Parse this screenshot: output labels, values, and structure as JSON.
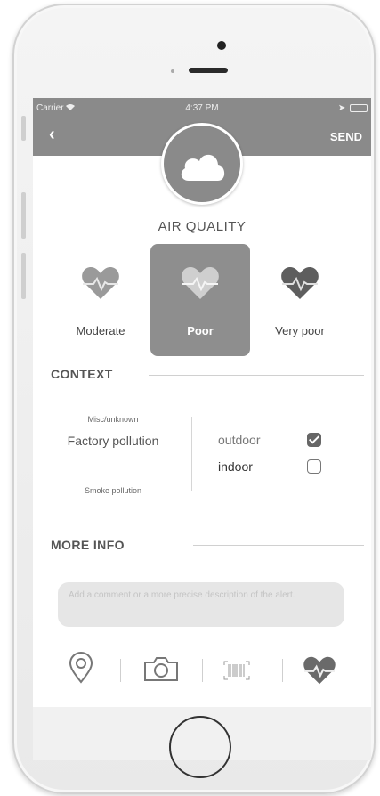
{
  "status_bar": {
    "carrier": "Carrier",
    "time": "4:37 PM"
  },
  "header": {
    "back": "‹",
    "send": "SEND",
    "icon": "cloud-icon"
  },
  "air_quality": {
    "title": "AIR QUALITY",
    "options": [
      {
        "label": "Moderate",
        "icon": "heart-pulse-icon",
        "selected": false
      },
      {
        "label": "Poor",
        "icon": "heart-pulse-icon",
        "selected": true
      },
      {
        "label": "Very poor",
        "icon": "heart-pulse-icon",
        "selected": false
      }
    ]
  },
  "context": {
    "title": "CONTEXT",
    "picker": [
      "Misc/unknown",
      "Factory pollution",
      "Smoke pollution"
    ],
    "location": [
      {
        "label": "outdoor",
        "checked": true
      },
      {
        "label": "indoor",
        "checked": false
      }
    ]
  },
  "more_info": {
    "title": "MORE INFO",
    "comment_placeholder": "Add a comment or a more precise description of the alert."
  },
  "toolbar": [
    "location-pin-icon",
    "camera-icon",
    "barcode-icon",
    "heart-pulse-icon"
  ],
  "colors": {
    "header": "#8a8a8a",
    "selected_tile": "#8e8e8e",
    "heart": "#6e6e6e"
  }
}
